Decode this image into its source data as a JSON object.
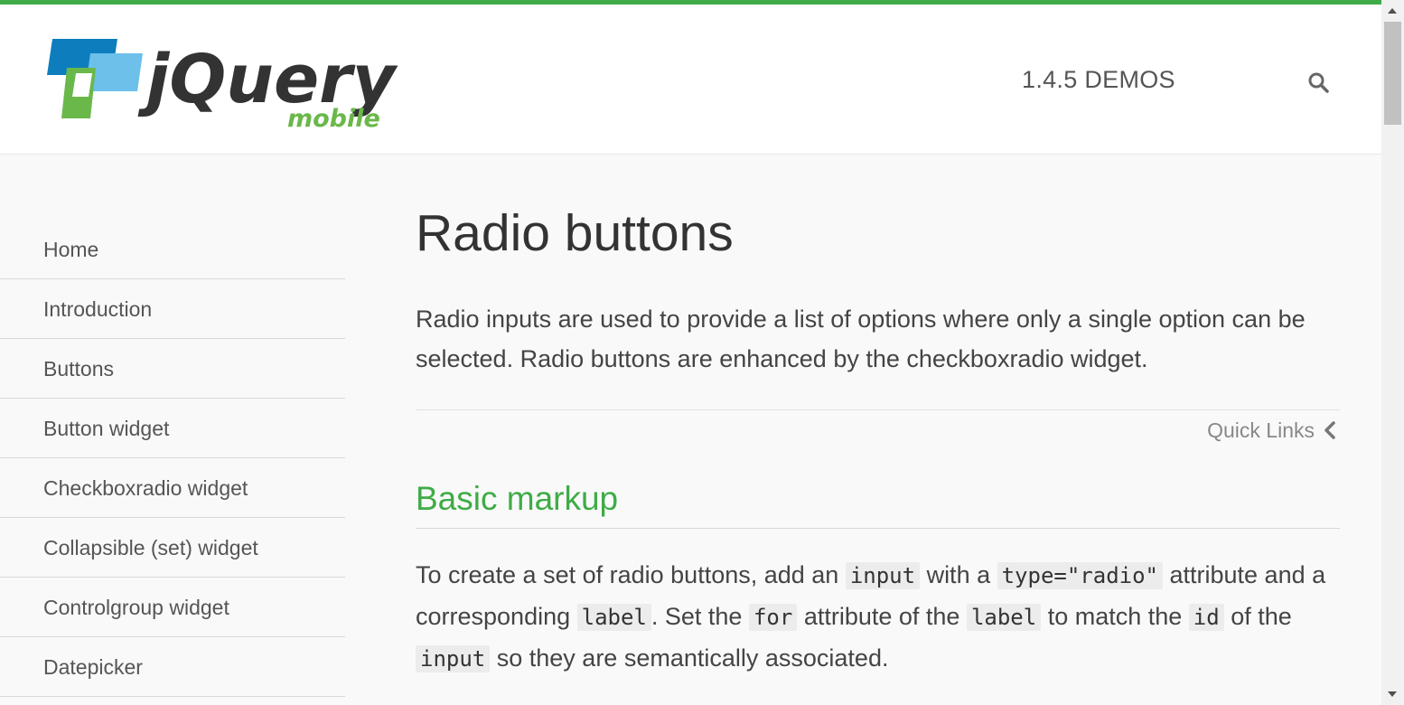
{
  "header": {
    "logo_text": "jQuery",
    "logo_sub": "mobile",
    "demos_label": "1.4.5 DEMOS",
    "search_icon": "search-icon"
  },
  "sidebar": {
    "items": [
      {
        "label": "Home"
      },
      {
        "label": "Introduction"
      },
      {
        "label": "Buttons"
      },
      {
        "label": "Button widget"
      },
      {
        "label": "Checkboxradio widget"
      },
      {
        "label": "Collapsible (set) widget"
      },
      {
        "label": "Controlgroup widget"
      },
      {
        "label": "Datepicker"
      }
    ]
  },
  "main": {
    "title": "Radio buttons",
    "intro": "Radio inputs are used to provide a list of options where only a single option can be selected. Radio buttons are enhanced by the checkboxradio widget.",
    "quick_links": "Quick Links",
    "section_title": "Basic markup",
    "body": {
      "t1": "To create a set of radio buttons, add an ",
      "c1": "input",
      "t2": " with a ",
      "c2": "type=\"radio\"",
      "t3": " attribute and a corresponding ",
      "c3": "label",
      "t4": ". Set the ",
      "c4": "for",
      "t5": " attribute of the ",
      "c5": "label",
      "t6": " to match the ",
      "c6": "id",
      "t7": " of the ",
      "c7": "input",
      "t8": " so they are semantically associated."
    }
  },
  "colors": {
    "accent_green": "#3fac47",
    "logo_blue": "#1b8fc9",
    "logo_dark": "#333333"
  }
}
